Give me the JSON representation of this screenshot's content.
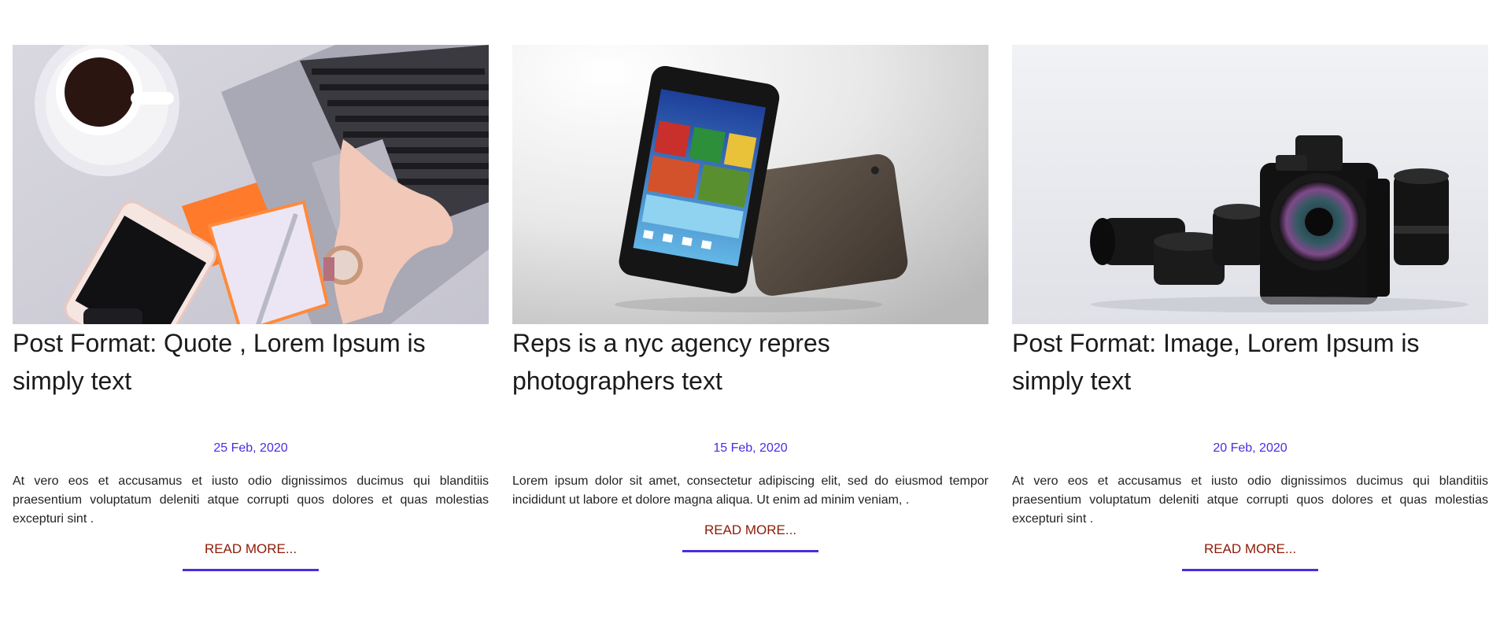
{
  "posts": [
    {
      "title": "Post Format: Quote , Lorem Ipsum is simply text",
      "date": "25 Feb, 2020",
      "excerpt": "At vero eos et accusamus et iusto odio dignissimos ducimus qui blanditiis praesentium voluptatum deleniti atque corrupti quos dolores et quas molestias excepturi sint .",
      "read_more": "READ MORE...",
      "image": "laptop-desk-photo"
    },
    {
      "title": "Reps is a nyc agency repres photographers text",
      "date": "15 Feb, 2020",
      "excerpt": "Lorem ipsum dolor sit amet, consectetur adipiscing elit, sed do eiusmod tempor incididunt ut labore et dolore magna aliqua. Ut enim ad minim veniam, .",
      "read_more": "READ MORE...",
      "image": "tablet-photo"
    },
    {
      "title": "Post Format: Image, Lorem Ipsum is simply text",
      "date": "20 Feb, 2020",
      "excerpt": "At vero eos et accusamus et iusto odio dignissimos ducimus qui blanditiis praesentium voluptatum deleniti atque corrupti quos dolores et quas molestias excepturi sint .",
      "read_more": "READ MORE...",
      "image": "camera-lenses-photo"
    }
  ],
  "colors": {
    "accent": "#4a2de0",
    "read_more": "#8b1a06",
    "title": "#1b1b1b"
  }
}
